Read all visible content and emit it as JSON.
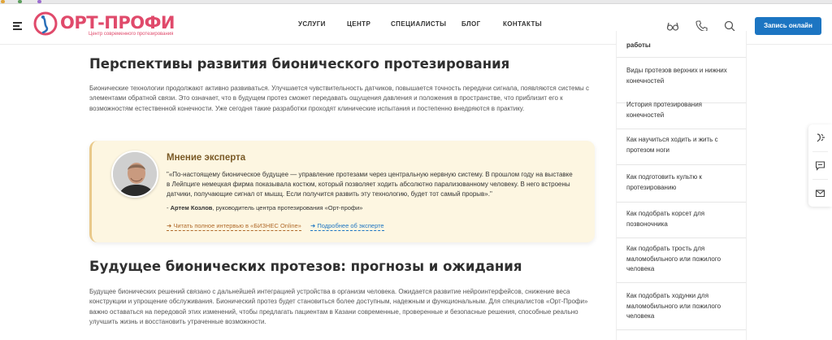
{
  "header": {
    "logo_text": "ОРТ-ПРОФИ",
    "logo_tagline": "Центр современного протезирования",
    "nav": [
      "УСЛУГИ",
      "ЦЕНТР",
      "СПЕЦИАЛИСТЫ",
      "БЛОГ",
      "КОНТАКТЫ"
    ],
    "icons": [
      "vision-icon",
      "phone-icon",
      "search-icon"
    ],
    "cta_label": "Запись онлайн",
    "colors": {
      "brand": "#e04a6b",
      "accent": "#1c75c2"
    }
  },
  "article": {
    "section1_title": "Перспективы развития бионического протезирования",
    "section1_text": "Бионические технологии продолжают активно развиваться. Улучшается чувствительность датчиков, повышается точность передачи сигнала, появляются системы с элементами обратной связи. Это означает, что в будущем протез сможет передавать ощущения давления и положения в пространстве, что приблизит его к возможностям естественной конечности. Уже сегодня такие разработки проходят клинические испытания и постепенно внедряются в практику.",
    "expert": {
      "title": "Мнение эксперта",
      "quote": "\"«По-настоящему бионическое будущее — управление протезами через центральную нервную систему. В прошлом году на выставке в Лейпциге немецкая фирма показывала костюм, который позволяет ходить абсолютно парализованному человеку. В него встроены датчики, получающие сигнал от мышц. Если получится развить эту технологию, будет тот самый прорыв».\"",
      "author_prefix": "- ",
      "author_name": "Артем Козлов",
      "author_role": ", руководитель центра протезирования «Орт-профи»",
      "link1": "➜ Читать полное интервью в «БИЗНЕС Online»",
      "link2": "➜ Подробнее об эксперте"
    },
    "section2_title": "Будущее бионических протезов: прогнозы и ожидания",
    "section2_text": "Будущее бионических решений связано с дальнейшей интеграцией устройства в организм человека. Ожидается развитие нейроинтерфейсов, снижение веса конструкции и упрощение обслуживания. Бионический протез будет становиться более доступным, надежным и функциональным. Для специалистов «Орт-Профи» важно оставаться на передовой этих изменений, чтобы предлагать пациентам в Казани современные, проверенные и безопасные решения, способные реально улучшить жизнь и восстановить утраченные возможности."
  },
  "sidebar": {
    "items": [
      "работы",
      "Виды протезов верхних и нижних конечностей",
      "История протезирования конечностей",
      "Как научиться ходить и жить с протезом ноги",
      "Как подготовить культю к протезированию",
      "Как подобрать корсет для позвоночника",
      "Как подобрать трость для маломобильного или пожилого человека",
      "Как подобрать ходунки для маломобильного или пожилого человека"
    ]
  },
  "right_rail": {
    "icons": [
      "feedback-icon",
      "chat-icon",
      "mail-icon"
    ]
  }
}
